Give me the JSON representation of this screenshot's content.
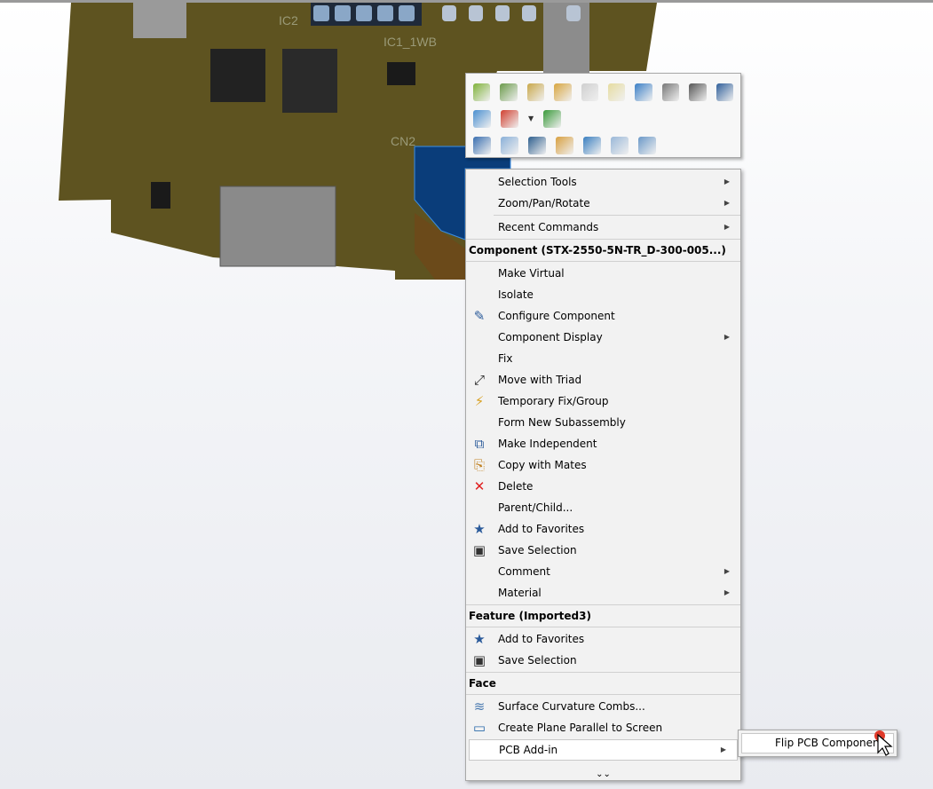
{
  "viewport": {
    "labels": [
      "IC2",
      "IC1_1WB",
      "CN2"
    ],
    "board_color": "#5e5320",
    "selected_face_color": "#0a3d7a"
  },
  "context_toolbar": {
    "rows": [
      [
        "open-part-icon",
        "insert-component-icon",
        "replace-component-icon",
        "edit-component-icon",
        "hide-component-icon",
        "show-icon",
        "move-down-icon",
        "mates-icon",
        "view-mates-icon",
        "properties-icon"
      ],
      [
        "edit-appearance-icon",
        "appearance-icon",
        "appearances-menu-icon"
      ],
      [
        "select-icon",
        "sketch-icon",
        "zoom-to-selection-icon",
        "normal-to-icon",
        "insert-reference-icon",
        "isolate-icon",
        "view-orientation-icon"
      ]
    ]
  },
  "menu": {
    "top_items": [
      {
        "label": "Selection Tools",
        "submenu": true
      },
      {
        "label": "Zoom/Pan/Rotate",
        "submenu": true
      },
      {
        "label": "Recent Commands",
        "submenu": true
      }
    ],
    "component_header": "Component (STX-2550-5N-TR_D-300-005...)",
    "component_items": [
      {
        "label": "Make Virtual"
      },
      {
        "label": "Isolate"
      },
      {
        "label": "Configure Component",
        "icon": "configure-icon"
      },
      {
        "label": "Component Display",
        "submenu": true
      },
      {
        "label": "Fix"
      },
      {
        "label": "Move with Triad",
        "icon": "triad-icon"
      },
      {
        "label": "Temporary Fix/Group",
        "icon": "temp-fix-icon"
      },
      {
        "label": "Form New Subassembly"
      },
      {
        "label": "Make Independent",
        "icon": "make-independent-icon"
      },
      {
        "label": "Copy with Mates",
        "icon": "copy-mates-icon"
      },
      {
        "label": "Delete",
        "icon": "delete-icon"
      },
      {
        "label": "Parent/Child..."
      },
      {
        "label": "Add to Favorites",
        "icon": "favorites-icon"
      },
      {
        "label": "Save Selection",
        "icon": "save-selection-icon"
      },
      {
        "label": "Comment",
        "submenu": true
      },
      {
        "label": "Material",
        "submenu": true
      }
    ],
    "feature_header": "Feature (Imported3)",
    "feature_items": [
      {
        "label": "Add to Favorites",
        "icon": "favorites-icon"
      },
      {
        "label": "Save Selection",
        "icon": "save-selection-icon"
      }
    ],
    "face_header": "Face",
    "face_items": [
      {
        "label": "Surface Curvature Combs...",
        "icon": "curvature-icon"
      },
      {
        "label": "Create Plane Parallel to Screen",
        "icon": "plane-icon"
      }
    ],
    "pcb_item": {
      "label": "PCB Add-in",
      "submenu": true
    },
    "more": "⌄⌄"
  },
  "submenu": {
    "items": [
      {
        "label": "Flip PCB Component"
      }
    ]
  }
}
